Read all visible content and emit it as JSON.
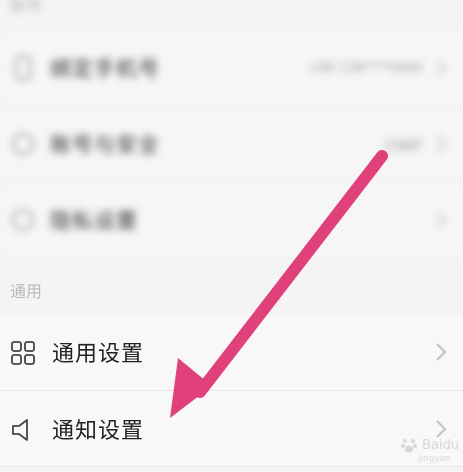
{
  "top_section": {
    "label": "账号"
  },
  "blurred_rows": [
    {
      "label": "绑定手机号",
      "value": "+86 138****0000"
    },
    {
      "label": "账号与安全",
      "value": "已保护"
    },
    {
      "label": "隐私设置",
      "value": ""
    }
  ],
  "general_section": {
    "label": "通用"
  },
  "general_rows": [
    {
      "label": "通用设置",
      "icon": "grid-icon"
    },
    {
      "label": "通知设置",
      "icon": "speaker-icon"
    }
  ],
  "annotation": {
    "color": "#e0417a"
  },
  "watermark": {
    "text": "Baidu",
    "sub": "jingyan"
  }
}
